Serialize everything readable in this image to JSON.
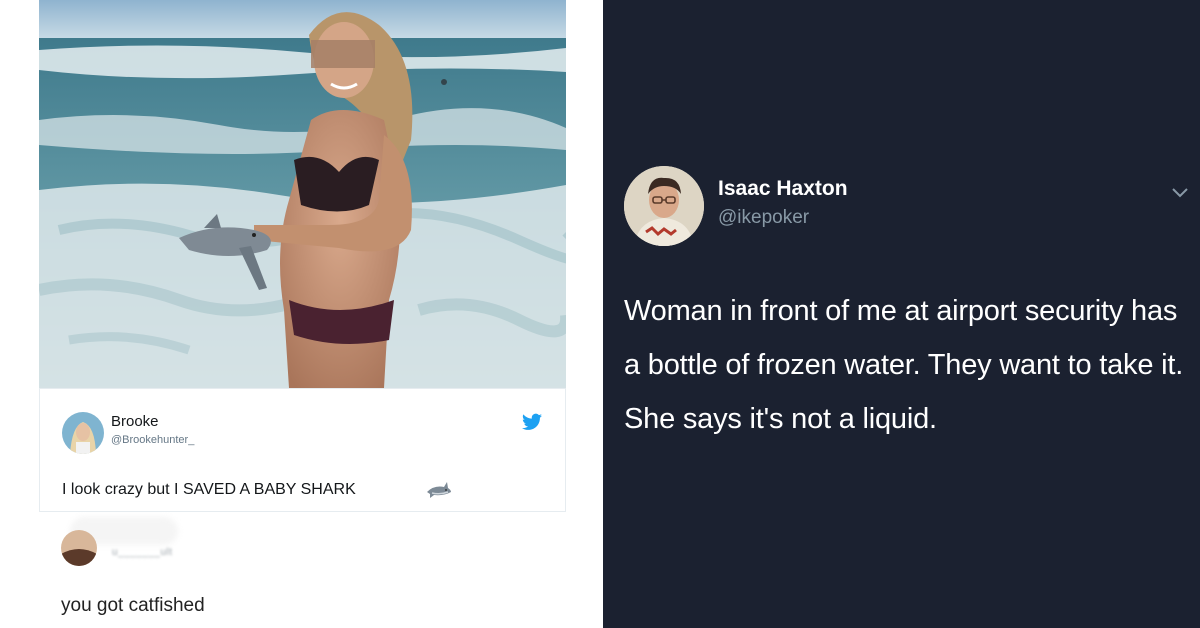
{
  "left_tweet": {
    "photo_alt": "Girl on beach holding a baby shark",
    "author_name": "Brooke",
    "author_handle": "@Brookehunter_",
    "text": "I look crazy but I SAVED A BABY SHARK",
    "icons": {
      "platform": "twitter-bird-icon",
      "emoji": "shark-emoji-icon"
    },
    "accent_color": "#1da1f2"
  },
  "reply": {
    "handle_obscured": "u_______ult",
    "text": "you got catfished"
  },
  "right_tweet": {
    "author_name": "Isaac Haxton",
    "author_handle": "@ikepoker",
    "text": "Woman in front of me at airport security has a bottle of frozen water. They want to take it. She says it's not a liquid.",
    "icons": {
      "menu": "chevron-down-icon"
    },
    "background_color": "#1b2130"
  }
}
